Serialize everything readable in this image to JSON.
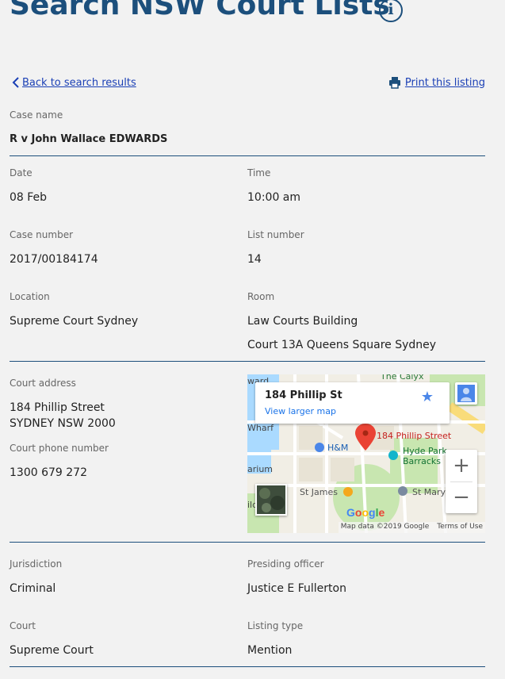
{
  "header": {
    "title": "Search NSW Court Lists",
    "info_icon": "info-circle-icon"
  },
  "nav": {
    "back_label": "Back to search results",
    "print_label": "Print this listing"
  },
  "case": {
    "case_name_label": "Case name",
    "case_name": "R v John Wallace EDWARDS",
    "date_label": "Date",
    "date": "08 Feb",
    "time_label": "Time",
    "time": "10:00 am",
    "case_number_label": "Case number",
    "case_number": "2017/00184174",
    "list_number_label": "List number",
    "list_number": "14",
    "location_label": "Location",
    "location": "Supreme Court Sydney",
    "room_label": "Room",
    "room_line1": "Law Courts Building",
    "room_line2": "Court 13A Queens Square Sydney"
  },
  "address": {
    "court_address_label": "Court address",
    "line1": "184 Phillip Street",
    "line2": "SYDNEY NSW 2000",
    "phone_label": "Court phone number",
    "phone": "1300 679 272"
  },
  "map": {
    "card_title": "184 Phillip St",
    "card_link": "View larger map",
    "pin_label": "184 Phillip Street",
    "labels": {
      "calyx": "The Calyx",
      "ward": "ward",
      "wharf": "Wharf",
      "hm": "H&M",
      "hyde_park": "Hyde Park",
      "barracks": "Barracks",
      "arium": "arium",
      "st_james": "St James",
      "st_mary": "St Mary",
      "ild": "ild"
    },
    "attribution": "Map data ©2019 Google",
    "terms": "Terms of Use",
    "logo": "Google",
    "zoom_in": "+",
    "zoom_out": "−"
  },
  "details": {
    "jurisdiction_label": "Jurisdiction",
    "jurisdiction": "Criminal",
    "presiding_label": "Presiding officer",
    "presiding": "Justice E Fullerton",
    "court_label": "Court",
    "court": "Supreme Court",
    "listing_type_label": "Listing type",
    "listing_type": "Mention"
  },
  "colors": {
    "brand": "#1c4f7c",
    "link": "#1a3fb5",
    "pin": "#ea4335",
    "accent_blue": "#4a86e8"
  }
}
